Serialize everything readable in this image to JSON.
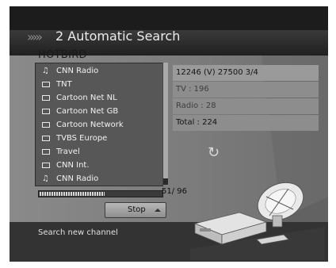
{
  "header": {
    "chevrons": "›››››",
    "title": "2 Automatic Search"
  },
  "satellite": {
    "name": "HOTBIRD"
  },
  "channel_list": {
    "items": [
      {
        "label": "CNN Radio",
        "icon": "music-note-icon"
      },
      {
        "label": "TNT",
        "icon": "tv-icon"
      },
      {
        "label": "Cartoon Net NL",
        "icon": "tv-icon"
      },
      {
        "label": "Cartoon Net GB",
        "icon": "tv-icon"
      },
      {
        "label": "Cartoon Network",
        "icon": "tv-icon"
      },
      {
        "label": "TVBS Europe",
        "icon": "tv-icon"
      },
      {
        "label": "Travel",
        "icon": "tv-icon"
      },
      {
        "label": "CNN Int.",
        "icon": "tv-icon"
      },
      {
        "label": "CNN Radio",
        "icon": "music-note-icon"
      }
    ]
  },
  "info": {
    "transponder": "12246 (V) 27500 3/4",
    "tv": "TV : 196",
    "radio": "Radio : 28",
    "total": "Total : 224"
  },
  "progress": {
    "count_text": "51/ 96",
    "value": 51,
    "max": 96
  },
  "buttons": {
    "stop_label": "Stop"
  },
  "footer": {
    "hint": "Search new channel"
  },
  "colors": {
    "background": "#7b7b7b",
    "list_background": "#575757",
    "title_bar": "#202020",
    "footer": "#333333"
  }
}
